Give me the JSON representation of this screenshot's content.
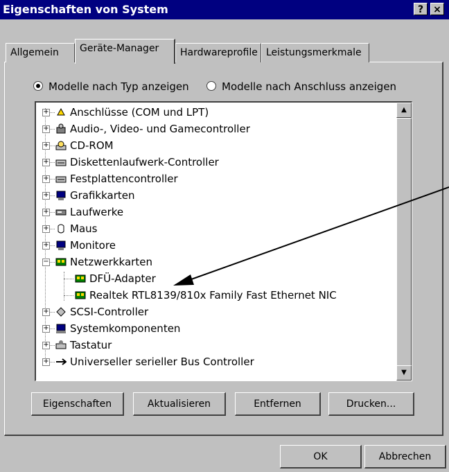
{
  "window": {
    "title": "Eigenschaften von System",
    "help_btn": "?",
    "close_btn": "×"
  },
  "tabs": [
    {
      "label": "Allgemein"
    },
    {
      "label": "Geräte-Manager"
    },
    {
      "label": "Hardwareprofile"
    },
    {
      "label": "Leistungsmerkmale"
    }
  ],
  "radios": [
    {
      "label": "Modelle nach Typ anzeigen",
      "checked": true
    },
    {
      "label": "Modelle nach Anschluss anzeigen",
      "checked": false
    }
  ],
  "tree": [
    {
      "label": "Anschlüsse (COM und LPT)",
      "icon": "port-icon"
    },
    {
      "label": "Audio-, Video- und Gamecontroller",
      "icon": "audio-icon"
    },
    {
      "label": "CD-ROM",
      "icon": "cdrom-icon"
    },
    {
      "label": "Diskettenlaufwerk-Controller",
      "icon": "floppy-controller-icon"
    },
    {
      "label": "Festplattencontroller",
      "icon": "harddisk-controller-icon"
    },
    {
      "label": "Grafikkarten",
      "icon": "display-adapter-icon"
    },
    {
      "label": "Laufwerke",
      "icon": "drive-icon"
    },
    {
      "label": "Maus",
      "icon": "mouse-icon"
    },
    {
      "label": "Monitore",
      "icon": "monitor-icon"
    },
    {
      "label": "Netzwerkkarten",
      "icon": "network-card-icon"
    },
    {
      "label": "DFÜ-Adapter",
      "icon": "network-card-icon",
      "child": true
    },
    {
      "label": "Realtek RTL8139/810x Family Fast Ethernet NIC",
      "icon": "network-card-icon",
      "child": true
    },
    {
      "label": "SCSI-Controller",
      "icon": "scsi-icon"
    },
    {
      "label": "Systemkomponenten",
      "icon": "system-icon"
    },
    {
      "label": "Tastatur",
      "icon": "keyboard-icon"
    },
    {
      "label": "Universeller serieller Bus Controller",
      "icon": "usb-icon"
    }
  ],
  "buttons": {
    "properties": "Eigenschaften",
    "update": "Aktualisieren",
    "remove": "Entfernen",
    "print": "Drucken...",
    "ok": "OK",
    "cancel": "Abbrechen"
  }
}
